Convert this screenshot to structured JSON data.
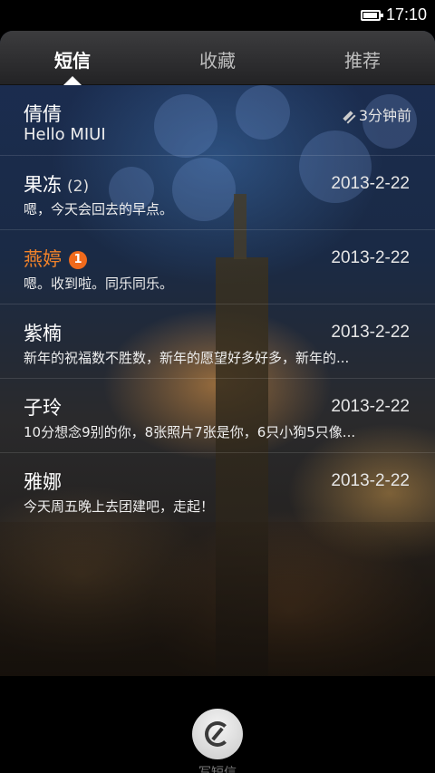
{
  "status_bar": {
    "time": "17:10",
    "battery_level": 0.85,
    "battery_icon": "battery-icon"
  },
  "tabs": [
    {
      "label": "短信",
      "active": true
    },
    {
      "label": "收藏",
      "active": false
    },
    {
      "label": "推荐",
      "active": false
    }
  ],
  "conversations": [
    {
      "name": "倩倩",
      "meta": "3分钟前",
      "preview": "Hello MIUI",
      "draft": true,
      "icon": "pencil-icon"
    },
    {
      "name": "果冻",
      "count": "(2)",
      "date": "2013-2-22",
      "preview": "嗯，今天会回去的早点。"
    },
    {
      "name": "燕婷",
      "badge": "1",
      "date": "2013-2-22",
      "preview": "嗯。收到啦。同乐同乐。",
      "highlight_color": "#f0822a"
    },
    {
      "name": "紫楠",
      "date": "2013-2-22",
      "preview": "新年的祝福数不胜数，新年的愿望好多好多，新年的..."
    },
    {
      "name": "子玲",
      "date": "2013-2-22",
      "preview": "10分想念9别的你，8张照片7张是你，6只小狗5只像..."
    },
    {
      "name": "雅娜",
      "date": "2013-2-22",
      "preview": "今天周五晚上去团建吧，走起！"
    }
  ],
  "compose": {
    "label": "写短信",
    "icon": "compose-icon"
  },
  "colors": {
    "accent_orange": "#f06a1c",
    "highlight_name": "#f0822a"
  }
}
